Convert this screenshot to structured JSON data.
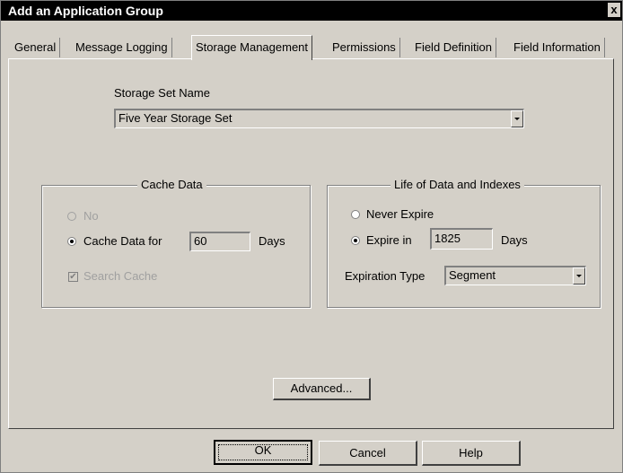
{
  "window": {
    "title": "Add an Application Group",
    "close_glyph": "x"
  },
  "tabs": [
    {
      "label": "General"
    },
    {
      "label": "Message Logging"
    },
    {
      "label": "Storage Management"
    },
    {
      "label": "Permissions"
    },
    {
      "label": "Field Definition"
    },
    {
      "label": "Field Information"
    }
  ],
  "active_tab": "Storage Management",
  "storage_set": {
    "label": "Storage Set Name",
    "value": "Five Year Storage Set"
  },
  "cache_data": {
    "title": "Cache Data",
    "no_label": "No",
    "cache_for_label": "Cache Data for",
    "days_value": "60",
    "days_label": "Days",
    "search_cache_label": "Search Cache",
    "selected": "cache_for",
    "search_cache_checked": true
  },
  "life_of_data": {
    "title": "Life of Data and Indexes",
    "never_expire_label": "Never Expire",
    "expire_in_label": "Expire in",
    "expire_days_value": "1825",
    "days_label": "Days",
    "selected": "expire_in",
    "expiration_type_label": "Expiration Type",
    "expiration_type_value": "Segment"
  },
  "advanced_button": "Advanced...",
  "footer_buttons": {
    "ok": "OK",
    "cancel": "Cancel",
    "help": "Help"
  },
  "colors": {
    "dialog_bg": "#d4d0c8",
    "titlebar_bg": "#000000",
    "titlebar_text": "#ffffff"
  }
}
